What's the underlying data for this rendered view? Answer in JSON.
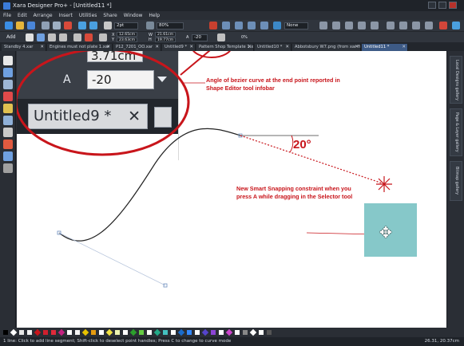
{
  "window": {
    "title": "Xara Designer Pro+ - [Untitled11 *]"
  },
  "menu": [
    "File",
    "Edit",
    "Arrange",
    "Insert",
    "Utilities",
    "Share",
    "Window",
    "Help"
  ],
  "toolbar": {
    "line_width": "2pt",
    "zoom": "80%",
    "quality": "None",
    "add_label": "Add",
    "x_value": "12.65cm",
    "y_value": "23.63cm",
    "w_value": "21.61cm",
    "h_value": "19.77cm",
    "angle_value": "-20",
    "percent": "0%"
  },
  "tabs": [
    {
      "label": "Standby 4.xar",
      "active": false
    },
    {
      "label": "Engines must not plate 1.xar",
      "active": false
    },
    {
      "label": "P12_7201_OO.xar",
      "active": false
    },
    {
      "label": "Untitled9 *",
      "active": false
    },
    {
      "label": "Pattern Shop Template 1.xar",
      "active": false
    },
    {
      "label": "Untitled10 *",
      "active": false
    },
    {
      "label": "Abbotsbury W7.png (from xar file)",
      "active": false
    },
    {
      "label": "Untitled11 *",
      "active": true
    }
  ],
  "right_panels": [
    "Local Designs gallery",
    "Page & Layer gallery",
    "Bitmap gallery"
  ],
  "zoom_inset": {
    "partial_value": "3.71cm",
    "label": "A",
    "angle_field": "-20",
    "tab_label": "Untitled9 *",
    "tab_close": "✕"
  },
  "annotations": {
    "angle_note": "Angle of bezier curve at the end point reported in Shape Editor tool infobar",
    "angle_degrees": "20°",
    "snapping_note": "New Smart Snapping constraint when you press A while dragging in the Selector tool"
  },
  "palette_colors": [
    "#000000",
    "#ffffff",
    "#e6e6e6",
    "#f2f2f2",
    "#c8151b",
    "#d11f2e",
    "#e02a3a",
    "#c32080",
    "#ffffff",
    "#f4f4f4",
    "#e8c200",
    "#e59b10",
    "#ffffff",
    "#f0e040",
    "#eef4b0",
    "#ffffff",
    "#2ca02c",
    "#66cc44",
    "#ffffff",
    "#22aa88",
    "#44c0c0",
    "#ffffff",
    "#1a6ccc",
    "#3388ff",
    "#ffffff",
    "#5544cc",
    "#8c44d6",
    "#ffffff",
    "#cc44cc",
    "#ffffff",
    "#888888",
    "#ffffff",
    "#ffffff",
    "#555555"
  ],
  "status": {
    "message": "1 line: Click to add line segment; Shift-click to deselect point handles; Press C to change to curve mode",
    "coords": "26.31, 20.37cm"
  }
}
